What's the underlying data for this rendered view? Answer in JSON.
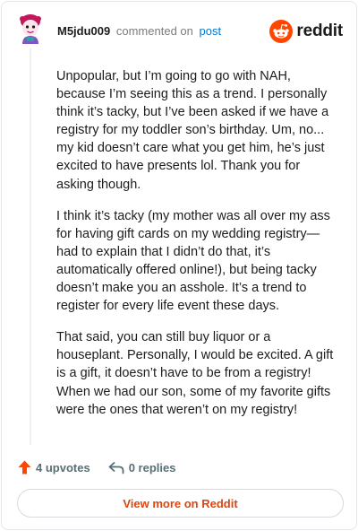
{
  "header": {
    "username": "M5jdu009",
    "commented_text": "commented on",
    "post_link": "post",
    "brand_word": "reddit"
  },
  "comment": {
    "paragraphs": [
      "Unpopular, but I’m going to go with NAH, because I’m seeing this as a trend. I personally think it’s tacky, but I’ve been asked if we have a registry for my toddler son’s birthday. Um, no... my kid doesn’t care what you get him, he’s just excited to have presents lol. Thank you for asking though.",
      "I think it’s tacky (my mother was all over my ass for having gift cards on my wedding registry— had to explain that I didn’t do that, it’s automatically offered online!), but being tacky doesn’t make you an asshole. It’s a trend to register for every life event these days.",
      "That said, you can still buy liquor or a houseplant. Personally, I would be excited. A gift is a gift, it doesn’t have to be from a registry! When we had our son, some of my favorite gifts were the ones that weren’t on my registry!"
    ]
  },
  "actions": {
    "upvotes": "4 upvotes",
    "replies": "0 replies"
  },
  "footer": {
    "view_more": "View more on Reddit"
  },
  "colors": {
    "accent": "#ff4500",
    "link": "#0079d3",
    "muted": "#576f76"
  },
  "icons": {
    "avatar": "user-avatar",
    "brand": "reddit-snoo-icon",
    "upvote": "upvote-arrow-icon",
    "reply": "reply-arrow-icon"
  }
}
